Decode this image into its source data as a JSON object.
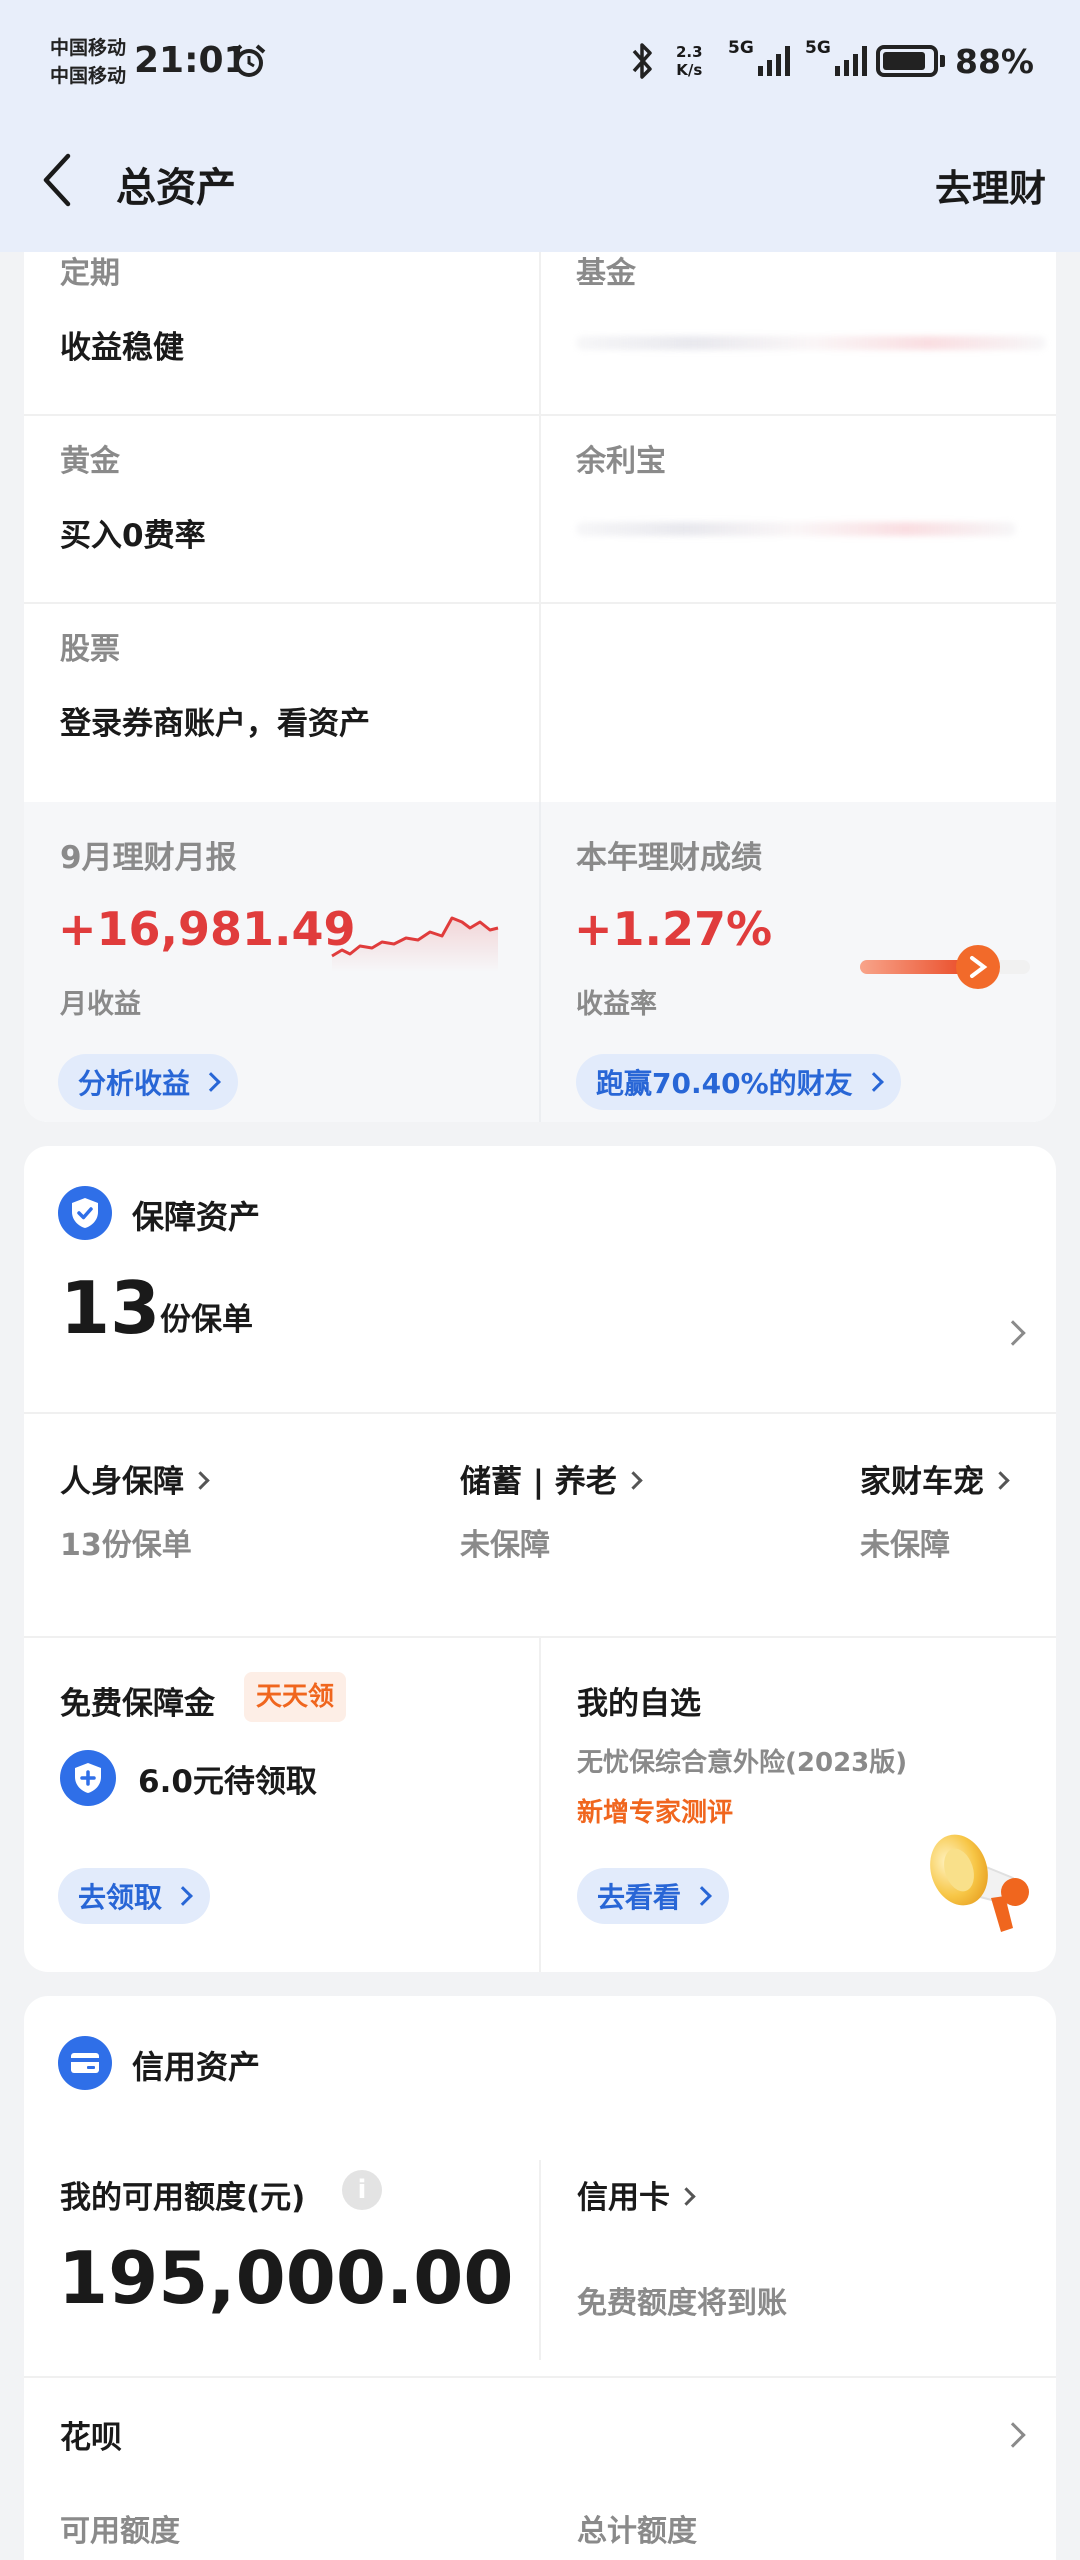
{
  "status_bar": {
    "carrier1": "中国移动",
    "carrier2": "中国移动",
    "time": "21:01",
    "speed_value": "2.3",
    "speed_unit": "K/s",
    "network1": "5G",
    "network2": "5G",
    "battery": "88%",
    "battery_level": 0.88
  },
  "header": {
    "title": "总资产",
    "right_link": "去理财"
  },
  "wealth": {
    "items": [
      {
        "label": "定期",
        "value": "收益稳健"
      },
      {
        "label": "基金",
        "value": ""
      },
      {
        "label": "黄金",
        "value": "买入0费率"
      },
      {
        "label": "余利宝",
        "value": ""
      },
      {
        "label": "股票",
        "value": "登录券商账户，看资产"
      }
    ],
    "monthly_report": {
      "title": "9月理财月报",
      "amount": "+16,981.49",
      "sub": "月收益",
      "button": "分析收益"
    },
    "yearly": {
      "title": "本年理财成绩",
      "rate": "+1.27%",
      "sub": "收益率",
      "button": "跑赢70.40%的财友"
    }
  },
  "insurance": {
    "title": "保障资产",
    "count": "13",
    "count_unit": "份保单",
    "categories": [
      {
        "label": "人身保障",
        "status": "13份保单"
      },
      {
        "label": "储蓄 | 养老",
        "status": "未保障"
      },
      {
        "label": "家财车宠",
        "status": "未保障"
      }
    ],
    "free": {
      "title": "免费保障金",
      "badge": "天天领",
      "amount": "6.0元待领取",
      "button": "去领取"
    },
    "favorites": {
      "title": "我的自选",
      "product": "无忧保综合意外险(2023版)",
      "highlight": "新增专家测评",
      "button": "去看看"
    }
  },
  "credit": {
    "title": "信用资产",
    "limit_label": "我的可用额度(元)",
    "limit_value": "195,000.00",
    "card_label": "信用卡",
    "card_status": "免费额度将到账",
    "huabei": "花呗",
    "available_label": "可用额度",
    "total_label": "总计额度"
  },
  "colors": {
    "header_bg": "#e8eefa",
    "accent_blue": "#2f6fe8",
    "gain_red": "#e03c3c",
    "highlight_orange": "#f0661e"
  }
}
